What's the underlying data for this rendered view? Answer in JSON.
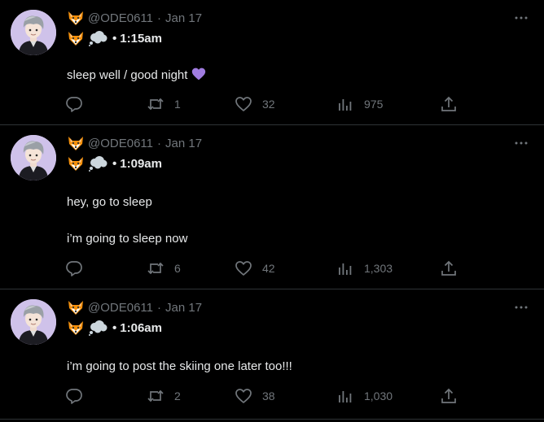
{
  "tweets": [
    {
      "handle": "@ODE0611",
      "date": "Jan 17",
      "name_time": "1:15am",
      "text_lines": [
        "sleep well / good night"
      ],
      "has_heart": true,
      "retweets": "1",
      "likes": "32",
      "views": "975"
    },
    {
      "handle": "@ODE0611",
      "date": "Jan 17",
      "name_time": "1:09am",
      "text_lines": [
        "hey, go to sleep",
        "i’m going to sleep now"
      ],
      "has_heart": false,
      "retweets": "6",
      "likes": "42",
      "views": "1,303"
    },
    {
      "handle": "@ODE0611",
      "date": "Jan 17",
      "name_time": "1:06am",
      "text_lines": [
        "i’m going to post the skiing one later too!!!"
      ],
      "has_heart": false,
      "retweets": "2",
      "likes": "38",
      "views": "1,030"
    }
  ],
  "separators": {
    "dot": "·",
    "bullet": "•"
  },
  "icons": [
    "fox-emoji",
    "thought-bubble-emoji",
    "purple-heart-emoji",
    "reply-icon",
    "retweet-icon",
    "like-icon",
    "views-icon",
    "share-icon",
    "more-icon"
  ],
  "colors": {
    "background": "#000000",
    "text": "#e7e9ea",
    "muted": "#71767b",
    "border": "#2f3336",
    "avatar_bg": "#cfc2ea",
    "heart": "#a07ce0"
  }
}
